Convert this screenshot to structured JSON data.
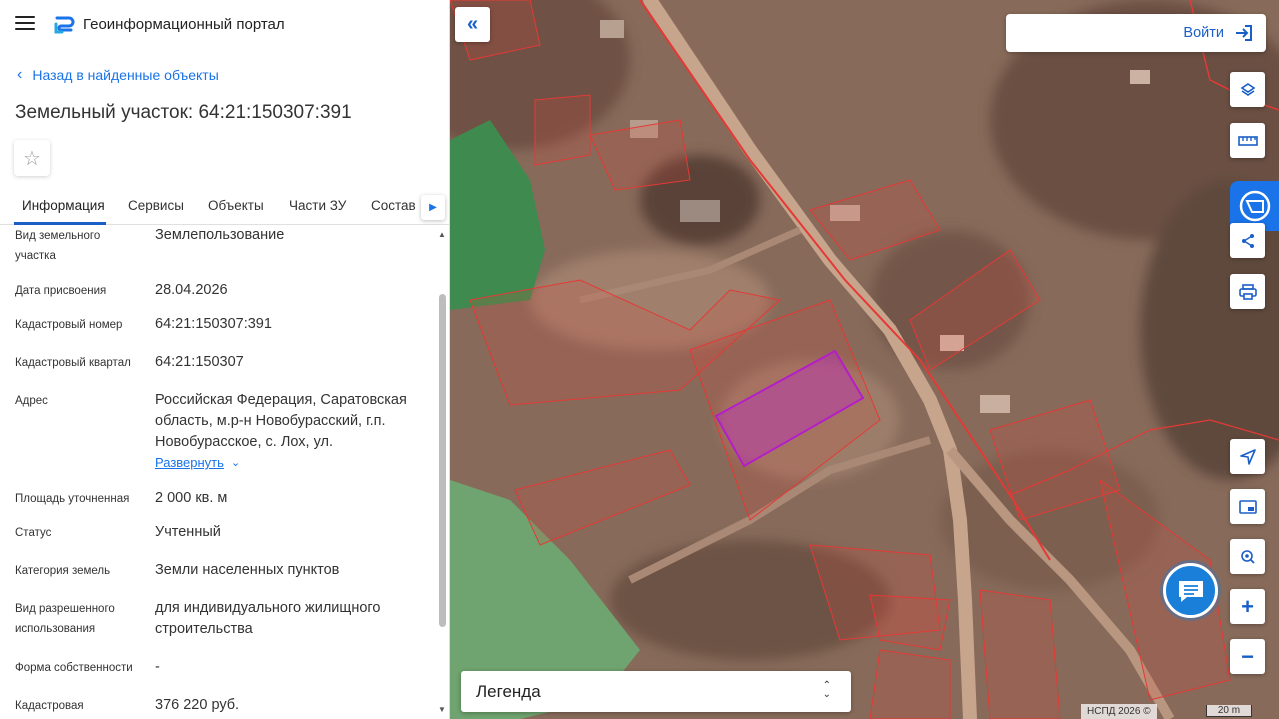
{
  "header": {
    "portal_title": "Геоинформационный портал"
  },
  "nav": {
    "back_label": "Назад в найденные объекты"
  },
  "object": {
    "title": "Земельный участок: 64:21:150307:391"
  },
  "tabs": [
    {
      "label": "Информация",
      "active": true
    },
    {
      "label": "Сервисы"
    },
    {
      "label": "Объекты"
    },
    {
      "label": "Части ЗУ"
    },
    {
      "label": "Состав"
    }
  ],
  "properties": [
    {
      "label": "Вид земельного участка",
      "value": "Землепользование"
    },
    {
      "label": "Дата присвоения",
      "value": "28.04.2026"
    },
    {
      "label": "Кадастровый номер",
      "value": "64:21:150307:391"
    },
    {
      "label": "Кадастровый квартал",
      "value": "64:21:150307"
    },
    {
      "label": "Адрес",
      "value": "Российская Федерация, Саратовская область, м.р-н Новобурасский, г.п. Новобурасское, с. Лох, ул."
    },
    {
      "label": "Площадь уточненная",
      "value": "2 000 кв. м"
    },
    {
      "label": "Статус",
      "value": "Учтенный"
    },
    {
      "label": "Категория земель",
      "value": "Земли населенных пунктов"
    },
    {
      "label": "Вид разрешенного использования",
      "value": "для индивидуального жилищного строительства"
    },
    {
      "label": "Форма собственности",
      "value": "-"
    },
    {
      "label": "Кадастровая",
      "value": "376 220 руб."
    }
  ],
  "address_expand_label": "Развернуть",
  "map": {
    "login_label": "Войти",
    "legend_label": "Легенда",
    "copyright": "НСПД 2026 ©",
    "scale_label": "20 m",
    "colors": {
      "parcel_outline": "#e53935",
      "selected_parcel": "#b41ec8",
      "accent": "#1a5fc7"
    }
  },
  "icons": {
    "menu": "hamburger-icon",
    "back": "chevron-left-icon",
    "favorite": "star-icon",
    "collapse": "double-chevron-left-icon",
    "login": "sign-in-icon",
    "layers": "layers-icon",
    "ruler": "ruler-icon",
    "share": "share-icon",
    "print": "print-icon",
    "locate": "location-arrow-icon",
    "minimap": "picture-in-picture-icon",
    "search_map": "map-search-icon",
    "zoom_in": "plus-icon",
    "zoom_out": "minus-icon",
    "chat": "chat-icon"
  }
}
